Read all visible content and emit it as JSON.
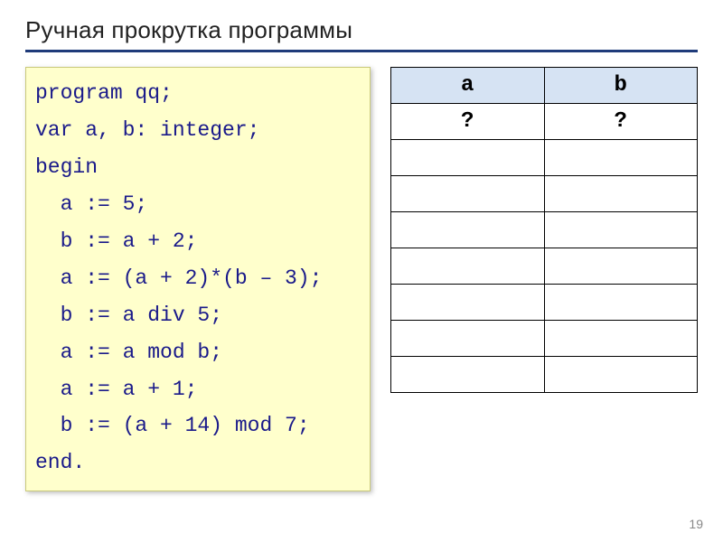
{
  "title": "Ручная прокрутка программы",
  "code": {
    "l0": "program qq;",
    "l1": "var a, b: integer;",
    "l2": "begin",
    "l3": "  a := 5;",
    "l4": "  b := a + 2;",
    "l5": "  a := (a + 2)*(b – 3);",
    "l6": "  b := a div 5;",
    "l7": "  a := a mod b;",
    "l8": "  a := a + 1;",
    "l9": "  b := (a + 14) mod 7;",
    "l10": "end."
  },
  "table": {
    "headers": {
      "a": "a",
      "b": "b"
    },
    "rows": [
      {
        "a": "?",
        "b": "?"
      },
      {
        "a": "",
        "b": ""
      },
      {
        "a": "",
        "b": ""
      },
      {
        "a": "",
        "b": ""
      },
      {
        "a": "",
        "b": ""
      },
      {
        "a": "",
        "b": ""
      },
      {
        "a": "",
        "b": ""
      },
      {
        "a": "",
        "b": ""
      }
    ]
  },
  "page_number": "19"
}
